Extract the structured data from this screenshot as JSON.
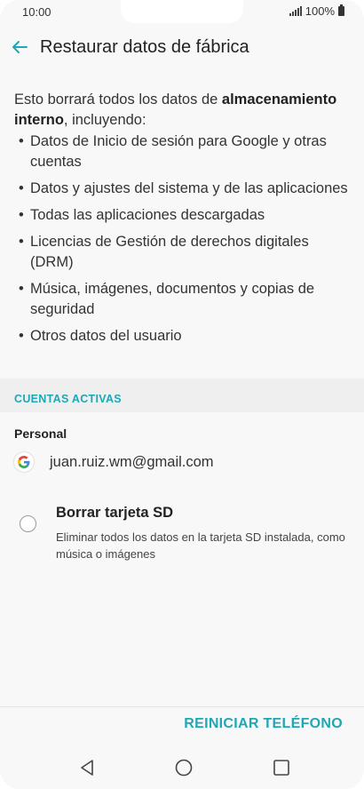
{
  "status_bar": {
    "time": "10:00",
    "battery": "100%"
  },
  "header": {
    "title": "Restaurar datos de fábrica",
    "back_icon": "arrow-left-icon"
  },
  "description": {
    "text_prefix": "Esto borrará todos los datos de ",
    "text_bold": "almacenamiento interno",
    "text_suffix": ", incluyendo:",
    "items": [
      "Datos de Inicio de sesión para Google y otras cuentas",
      "Datos y ajustes del sistema y de las aplicaciones",
      "Todas las aplicaciones descargadas",
      "Licencias de Gestión de derechos digitales (DRM)",
      "Música, imágenes, documentos y copias de seguridad",
      "Otros datos del usuario"
    ]
  },
  "accounts": {
    "section_title": "CUENTAS ACTIVAS",
    "group_label": "Personal",
    "email": "juan.ruiz.wm@gmail.com",
    "icon": "google-icon"
  },
  "sd_option": {
    "title": "Borrar tarjeta SD",
    "description": "Eliminar todos los datos en la tarjeta SD instalada, como música o imágenes",
    "checked": false
  },
  "actions": {
    "reset_label": "REINICIAR TELÉFONO"
  },
  "colors": {
    "accent": "#1ea7b5",
    "background": "#f8f8f8",
    "section_bg": "#efefef"
  }
}
